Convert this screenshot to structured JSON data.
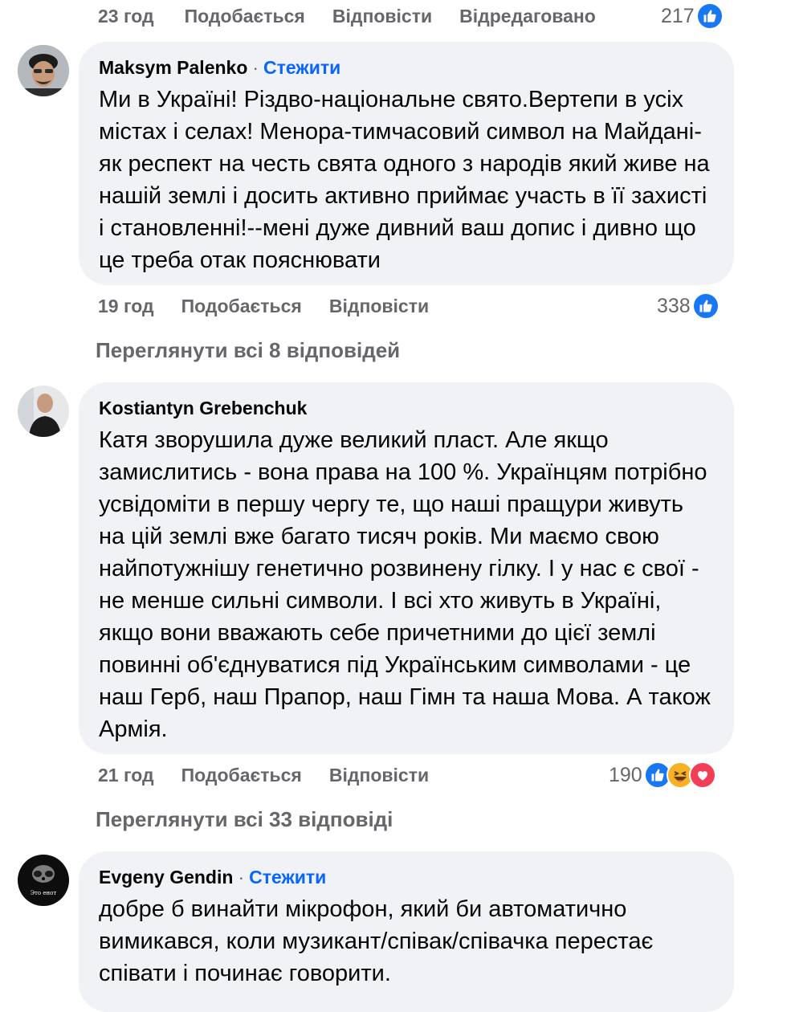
{
  "colors": {
    "bubble_bg": "#f0f2f5",
    "meta_text": "#65676b",
    "follow_blue": "#0866ff",
    "like_blue": "#1877f2",
    "haha_yellow": "#f7b125",
    "love_red": "#f33e58"
  },
  "top_actions": {
    "time": "23 год",
    "like": "Подобається",
    "reply": "Відповісти",
    "edited": "Відредаговано",
    "reaction_count": "217",
    "reaction_icons": [
      "like-icon"
    ]
  },
  "comments": [
    {
      "author": "Maksym Palenko",
      "follow": "Стежити",
      "text": "Ми в Україні! Різдво-національне свято.Вертепи в усіх містах і селах! Менора-тимчасовий символ на Майдані-як респект на честь свята одного з народів який живе на нашій землі і досить активно приймає участь в її захисті і становленні!--мені дуже дивний ваш допис і дивно що це треба отак пояснювати",
      "time": "19 год",
      "like": "Подобається",
      "reply": "Відповісти",
      "reaction_count": "338",
      "reaction_icons": [
        "like-icon"
      ],
      "view_replies": "Переглянути всі 8 відповідей"
    },
    {
      "author": "Kostiantyn Grebenchuk",
      "follow": "",
      "text": "Катя зворушила дуже великий пласт. Але якщо замислитись - вона права на 100 %. Українцям потрібно усвідоміти в першу чергу те, що наші пращури живуть на цій землі вже багато тисяч років. Ми маємо свою найпотужнішу генетично розвинену гілку. І у нас є свої - не менше сильні символи. І всі хто живуть в Україні, якщо вони вважають себе причетними до цієї землі повинні об'єднуватися під Українським символами - це наш Герб, наш Прапор, наш Гімн та наша Мова. А також Армія.",
      "time": "21 год",
      "like": "Подобається",
      "reply": "Відповісти",
      "reaction_count": "190",
      "reaction_icons": [
        "like-icon",
        "haha-icon",
        "love-icon"
      ],
      "view_replies": "Переглянути всі 33 відповіді"
    },
    {
      "author": "Evgeny Gendin",
      "follow": "Стежити",
      "text": "добре б винайти мікрофон, який би автоматично вимикався, коли музикант/співак/співачка перестає співати і починає говорити.",
      "avatar_caption": "Это енот"
    }
  ]
}
